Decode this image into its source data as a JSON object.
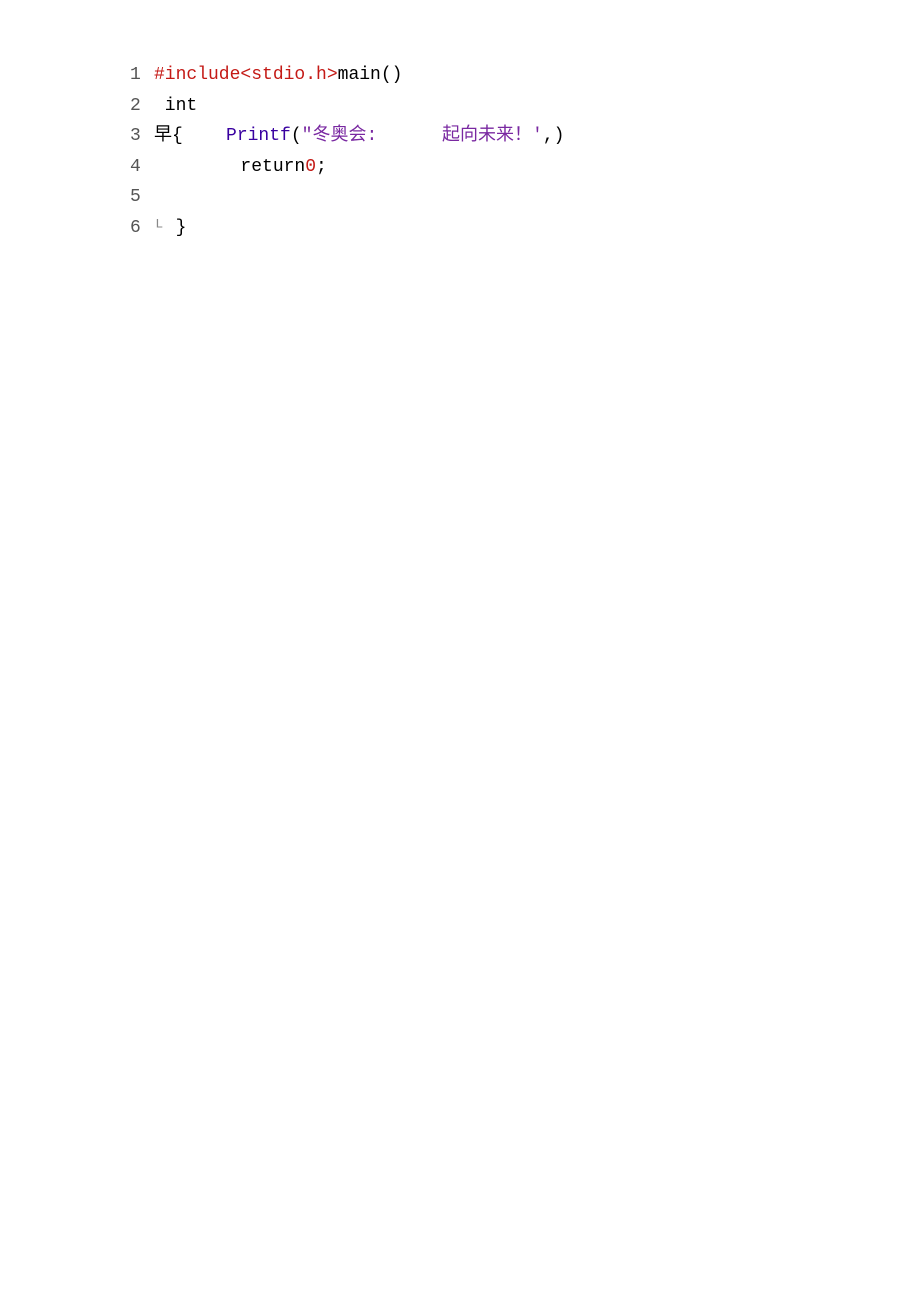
{
  "code": {
    "lines": [
      {
        "num": "1",
        "parts": [
          {
            "text": "#include<stdio.h>",
            "color": "preprocessor"
          },
          {
            "text": "main()",
            "color": "plain"
          }
        ]
      },
      {
        "num": "2",
        "parts": [
          {
            "text": " int",
            "color": "plain"
          }
        ]
      },
      {
        "num": "3",
        "parts": [
          {
            "text": "早{    ",
            "color": "plain"
          },
          {
            "text": "Printf",
            "color": "function"
          },
          {
            "text": "(",
            "color": "plain"
          },
          {
            "text": "“冬奥会:      起向未来！'",
            "color": "string"
          },
          {
            "text": ",)",
            "color": "plain"
          }
        ]
      },
      {
        "num": "4",
        "parts": [
          {
            "text": "        ",
            "color": "plain"
          },
          {
            "text": "return",
            "color": "plain"
          },
          {
            "text": "0",
            "color": "number"
          },
          {
            "text": ";",
            "color": "plain"
          }
        ]
      },
      {
        "num": "5",
        "parts": []
      },
      {
        "num": "6",
        "parts": [
          {
            "text": "ᴸ }",
            "color": "plain"
          }
        ]
      }
    ]
  }
}
